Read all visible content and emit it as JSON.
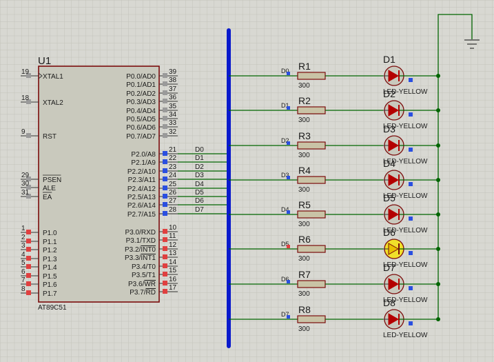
{
  "chip": {
    "ref": "U1",
    "part": "AT89C51",
    "left_pins": [
      {
        "num": "19",
        "name": "XTAL1",
        "clock": true
      },
      {
        "num": "18",
        "name": "XTAL2"
      },
      {
        "num": "9",
        "name": "RST"
      },
      {
        "num": "29",
        "name": "PSEN",
        "overline": true
      },
      {
        "num": "30",
        "name": "ALE"
      },
      {
        "num": "31",
        "name": "EA",
        "overline": true
      },
      {
        "num": "1",
        "name": "P1.0"
      },
      {
        "num": "2",
        "name": "P1.1"
      },
      {
        "num": "3",
        "name": "P1.2"
      },
      {
        "num": "4",
        "name": "P1.3"
      },
      {
        "num": "5",
        "name": "P1.4"
      },
      {
        "num": "6",
        "name": "P1.5"
      },
      {
        "num": "7",
        "name": "P1.6"
      },
      {
        "num": "8",
        "name": "P1.7"
      }
    ],
    "right_pins": [
      {
        "num": "39",
        "name": "P0.0/AD0"
      },
      {
        "num": "38",
        "name": "P0.1/AD1"
      },
      {
        "num": "37",
        "name": "P0.2/AD2"
      },
      {
        "num": "36",
        "name": "P0.3/AD3"
      },
      {
        "num": "35",
        "name": "P0.4/AD4"
      },
      {
        "num": "34",
        "name": "P0.5/AD5"
      },
      {
        "num": "33",
        "name": "P0.6/AD6"
      },
      {
        "num": "32",
        "name": "P0.7/AD7"
      },
      {
        "num": "21",
        "name": "P2.0/A8"
      },
      {
        "num": "22",
        "name": "P2.1/A9"
      },
      {
        "num": "23",
        "name": "P2.2/A10"
      },
      {
        "num": "24",
        "name": "P2.3/A11"
      },
      {
        "num": "25",
        "name": "P2.4/A12"
      },
      {
        "num": "26",
        "name": "P2.5/A13"
      },
      {
        "num": "27",
        "name": "P2.6/A14"
      },
      {
        "num": "28",
        "name": "P2.7/A15"
      },
      {
        "num": "10",
        "name": "P3.0/RXD"
      },
      {
        "num": "11",
        "name": "P3.1/TXD"
      },
      {
        "num": "12",
        "name": "P3.2/",
        "tail": "INT0"
      },
      {
        "num": "13",
        "name": "P3.3/",
        "tail": "INT1"
      },
      {
        "num": "14",
        "name": "P3.4/T0"
      },
      {
        "num": "15",
        "name": "P3.5/T1"
      },
      {
        "num": "16",
        "name": "P3.6/",
        "tail": "WR"
      },
      {
        "num": "17",
        "name": "P3.7/",
        "tail": "RD"
      }
    ]
  },
  "bus_labels": [
    "D0",
    "D1",
    "D2",
    "D3",
    "D4",
    "D5",
    "D6",
    "D7"
  ],
  "channels": [
    {
      "net": "D0",
      "res": "R1",
      "value": "300",
      "led": "D1",
      "led_label": "LED-YELLOW",
      "lit": false
    },
    {
      "net": "D1",
      "res": "R2",
      "value": "300",
      "led": "D2",
      "led_label": "LED-YELLOW",
      "lit": false
    },
    {
      "net": "D2",
      "res": "R3",
      "value": "300",
      "led": "D3",
      "led_label": "LED-YELLOW",
      "lit": false
    },
    {
      "net": "D3",
      "res": "R4",
      "value": "300",
      "led": "D4",
      "led_label": "LED-YELLOW",
      "lit": false
    },
    {
      "net": "D4",
      "res": "R5",
      "value": "300",
      "led": "D5",
      "led_label": "LED-YELLOW",
      "lit": false
    },
    {
      "net": "D5",
      "res": "R6",
      "value": "300",
      "led": "D6",
      "led_label": "LED-YELLOW",
      "lit": true
    },
    {
      "net": "D6",
      "res": "R7",
      "value": "300",
      "led": "D7",
      "led_label": "LED-YELLOW",
      "lit": false
    },
    {
      "net": "D7",
      "res": "R8",
      "value": "300",
      "led": "D8",
      "led_label": "LED-YELLOW",
      "lit": false
    }
  ],
  "colors": {
    "background": "#d8d8d2",
    "grid": "#c4c4bc",
    "wire": "#006400",
    "bus": "#0a1acc",
    "chip_fill": "#c9c9bd",
    "chip_border": "#7a0a0a",
    "resistor_fill": "#c9c3a6",
    "led_off": "#b40000",
    "led_on": "#f0e02a",
    "pin_marker": "#2a4fe0",
    "pin_marker_low": "#e04040",
    "pin_square": "#9a9a9a"
  }
}
